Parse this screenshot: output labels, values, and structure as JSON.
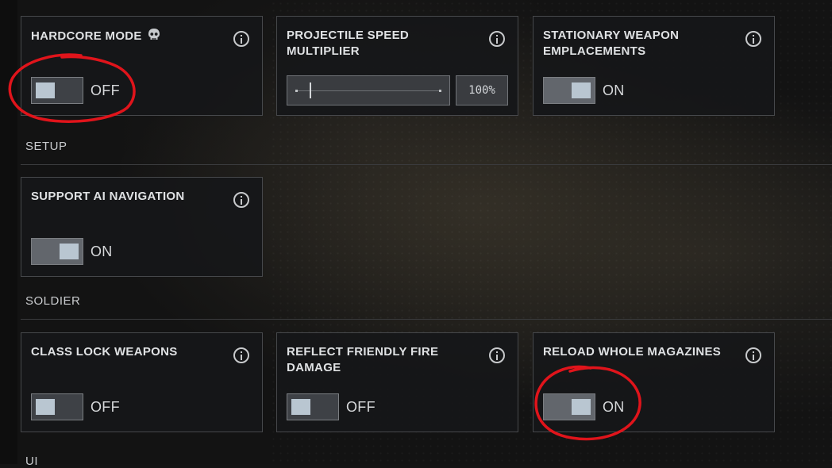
{
  "sections": {
    "setup_title": "SETUP",
    "soldier_title": "SOLDIER",
    "ui_title": "UI"
  },
  "cards": {
    "hardcore_mode": {
      "title": "HARDCORE MODE",
      "state": "OFF",
      "icon": "skull-icon"
    },
    "projectile_speed": {
      "title": "PROJECTILE SPEED MULTIPLIER",
      "value": "100%",
      "level_fraction": 0.09
    },
    "stationary_weapon": {
      "title": "STATIONARY WEAPON EMPLACEMENTS",
      "state": "ON"
    },
    "support_ai": {
      "title": "SUPPORT AI NAVIGATION",
      "state": "ON"
    },
    "class_lock": {
      "title": "CLASS LOCK WEAPONS",
      "state": "OFF"
    },
    "reflect_ff": {
      "title": "REFLECT FRIENDLY FIRE DAMAGE",
      "state": "OFF"
    },
    "reload_mags": {
      "title": "RELOAD WHOLE MAGAZINES",
      "state": "ON"
    }
  },
  "colors": {
    "annotation": "#e0141b",
    "toggle_knob": "#b9c6d1",
    "card_border": "#46484b"
  }
}
